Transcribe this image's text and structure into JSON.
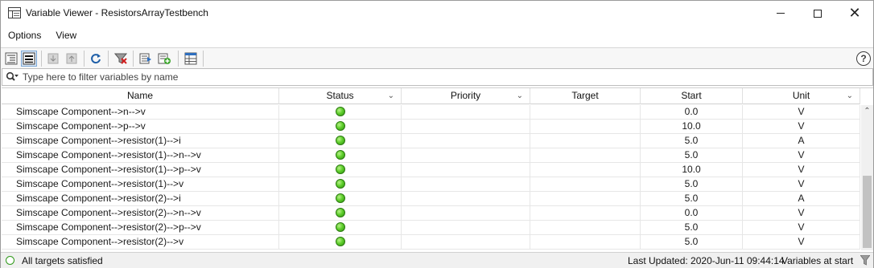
{
  "window": {
    "title": "Variable Viewer - ResistorsArrayTestbench",
    "icon": "table-window-icon"
  },
  "menu": {
    "items": [
      "Options",
      "View"
    ]
  },
  "toolbar": {
    "buttons": [
      "tree-view-icon",
      "flat-list-view-icon",
      "move-down-icon",
      "move-up-icon",
      "refresh-icon",
      "clear-filter-icon",
      "export-icon",
      "add-icon",
      "settings-table-icon"
    ],
    "help_label": "?"
  },
  "filter": {
    "placeholder": "Type here to filter variables by name",
    "value": ""
  },
  "table": {
    "columns": [
      "Name",
      "Status",
      "Priority",
      "Target",
      "Start",
      "Unit"
    ],
    "rows": [
      {
        "name": "Simscape Component-->n-->v",
        "status": "ok",
        "priority": "",
        "target": "",
        "start": "0.0",
        "unit": "V"
      },
      {
        "name": "Simscape Component-->p-->v",
        "status": "ok",
        "priority": "",
        "target": "",
        "start": "10.0",
        "unit": "V"
      },
      {
        "name": "Simscape Component-->resistor(1)-->i",
        "status": "ok",
        "priority": "",
        "target": "",
        "start": "5.0",
        "unit": "A"
      },
      {
        "name": "Simscape Component-->resistor(1)-->n-->v",
        "status": "ok",
        "priority": "",
        "target": "",
        "start": "5.0",
        "unit": "V"
      },
      {
        "name": "Simscape Component-->resistor(1)-->p-->v",
        "status": "ok",
        "priority": "",
        "target": "",
        "start": "10.0",
        "unit": "V"
      },
      {
        "name": "Simscape Component-->resistor(1)-->v",
        "status": "ok",
        "priority": "",
        "target": "",
        "start": "5.0",
        "unit": "V"
      },
      {
        "name": "Simscape Component-->resistor(2)-->i",
        "status": "ok",
        "priority": "",
        "target": "",
        "start": "5.0",
        "unit": "A"
      },
      {
        "name": "Simscape Component-->resistor(2)-->n-->v",
        "status": "ok",
        "priority": "",
        "target": "",
        "start": "0.0",
        "unit": "V"
      },
      {
        "name": "Simscape Component-->resistor(2)-->p-->v",
        "status": "ok",
        "priority": "",
        "target": "",
        "start": "5.0",
        "unit": "V"
      },
      {
        "name": "Simscape Component-->resistor(2)-->v",
        "status": "ok",
        "priority": "",
        "target": "",
        "start": "5.0",
        "unit": "V"
      }
    ]
  },
  "statusbar": {
    "message": "All targets satisfied",
    "last_updated": "Last Updated: 2020-Jun-11 09:44:14",
    "mode": "Variables at start"
  },
  "colors": {
    "status_ok": "#5fcf2c",
    "accent": "#7aa7d6"
  }
}
